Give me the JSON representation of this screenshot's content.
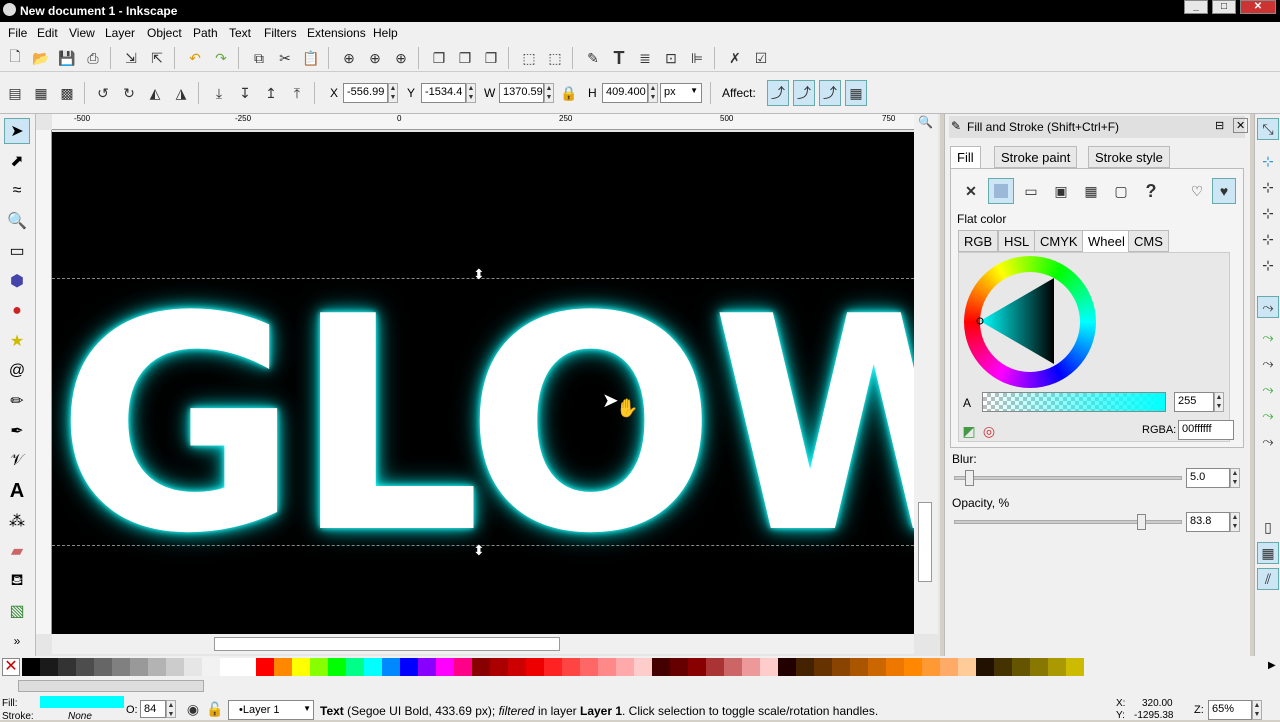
{
  "window": {
    "title": "New document 1 - Inkscape"
  },
  "menu": [
    "File",
    "Edit",
    "View",
    "Layer",
    "Object",
    "Path",
    "Text",
    "Filters",
    "Extensions",
    "Help"
  ],
  "controls": {
    "x_label": "X",
    "x_value": "-556.99",
    "y_label": "Y",
    "y_value": "-1534.4",
    "w_label": "W",
    "w_value": "1370.59",
    "h_label": "H",
    "h_value": "409.400",
    "unit": "px",
    "affect_label": "Affect:"
  },
  "ruler": {
    "ticks": [
      "-500",
      "-250",
      "0",
      "250",
      "500",
      "750"
    ]
  },
  "canvas": {
    "text": "GLOW"
  },
  "panel": {
    "title": "Fill and Stroke (Shift+Ctrl+F)",
    "tabs": [
      "Fill",
      "Stroke paint",
      "Stroke style"
    ],
    "flat_color_label": "Flat color",
    "color_modes": [
      "RGB",
      "HSL",
      "CMYK",
      "Wheel",
      "CMS"
    ],
    "active_mode": "Wheel",
    "alpha_label": "A",
    "alpha_value": "255",
    "rgba_label": "RGBA:",
    "rgba_value": "00ffffff",
    "blur_label": "Blur:",
    "blur_value": "5.0",
    "opacity_label": "Opacity, %",
    "opacity_value": "83.8"
  },
  "status": {
    "fill_label": "Fill:",
    "stroke_label": "Stroke:",
    "stroke_value": "None",
    "opacity_label": "O:",
    "opacity_value": "84",
    "layer": "•Layer 1",
    "message_prefix": "Text",
    "message_font": "(Segoe UI Bold, 433.69 px);",
    "message_filtered": "filtered",
    "message_in_layer": "in layer",
    "message_layer": "Layer 1",
    "message_rest": ". Click selection to toggle scale/rotation handles.",
    "coord_x_label": "X:",
    "coord_x": "320.00",
    "coord_y_label": "Y:",
    "coord_y": "-1295.38",
    "zoom_label": "Z:",
    "zoom": "65%"
  },
  "colors": {
    "glow": "#00ffff",
    "canvas": "#000000"
  }
}
